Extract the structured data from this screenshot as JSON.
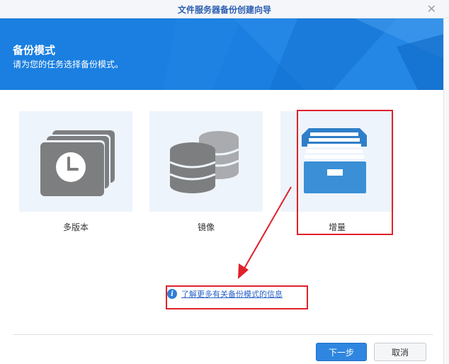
{
  "window": {
    "title": "文件服务器备份创建向导",
    "close_icon": "close-icon"
  },
  "banner": {
    "heading": "备份模式",
    "subtitle": "请为您的任务选择备份模式。"
  },
  "modes": [
    {
      "label": "多版本",
      "icon": "multi-version-clock-icon"
    },
    {
      "label": "镜像",
      "icon": "mirror-database-icon"
    },
    {
      "label": "增量",
      "icon": "incremental-file-drawer-icon"
    }
  ],
  "info": {
    "link_text": "了解更多有关备份模式的信息"
  },
  "footer": {
    "next_label": "下一步",
    "cancel_label": "取消"
  },
  "colors": {
    "banner": "#1a7fe0",
    "accent": "#2f86e0",
    "highlight": "#e0212a",
    "icon_gray": "#7d7e80",
    "drawer_blue": "#3a8fd6"
  }
}
